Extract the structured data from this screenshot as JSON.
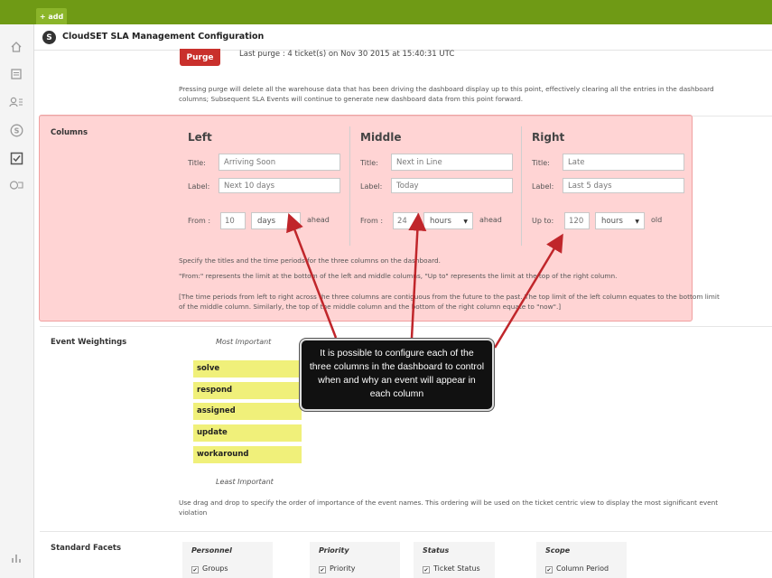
{
  "topbar": {
    "add_label": "+ add"
  },
  "header": {
    "title": "CloudSET SLA Management Configuration"
  },
  "purge": {
    "button_label": "Purge",
    "last_purge": "Last purge : 4 ticket(s) on Nov 30 2015 at 15:40:31 UTC",
    "description": "Pressing purge will delete all the warehouse data that has been driving the dashboard display up to this point, effectively clearing all the entries in the dashboard columns; Subsequent SLA Events will continue to generate new dashboard data from this point forward."
  },
  "columns": {
    "section_label": "Columns",
    "title_label": "Title:",
    "label_label": "Label:",
    "items": [
      {
        "heading": "Left",
        "title": "Arriving Soon",
        "label": "Next 10 days",
        "range_label": "From :",
        "amount": "10",
        "unit": "days",
        "suffix": "ahead"
      },
      {
        "heading": "Middle",
        "title": "Next in Line",
        "label": "Today",
        "range_label": "From :",
        "amount": "24",
        "unit": "hours",
        "suffix": "ahead"
      },
      {
        "heading": "Right",
        "title": "Late",
        "label": "Last 5 days",
        "range_label": "Up to:",
        "amount": "120",
        "unit": "hours",
        "suffix": "old"
      }
    ],
    "desc1": "Specify the titles and the time periods for the three columns on the dashboard.",
    "desc2": "\"From:\" represents the limit at the bottom of the left and middle columns, \"Up to\" represents the limit at the top of the right column.",
    "desc3": "[The time periods from left to right across the three columns are contiguous from the future to the past. The top limit of the left column equates to the bottom limit of the middle column. Similarly, the top of the middle column and the bottom of the right column equate to \"now\".]"
  },
  "event_weightings": {
    "section_label": "Event Weightings",
    "most": "Most Important",
    "least": "Least Important",
    "items": [
      "solve",
      "respond",
      "assigned",
      "update",
      "workaround"
    ],
    "description": "Use drag and drop to specify the order of importance of the event names. This ordering will be used on the ticket centric view to display the most significant event violation"
  },
  "standard_facets": {
    "section_label": "Standard Facets",
    "groups": [
      {
        "title": "Personnel",
        "item": "Groups"
      },
      {
        "title": "Priority",
        "item": "Priority"
      },
      {
        "title": "Status",
        "item": "Ticket Status"
      },
      {
        "title": "Scope",
        "item": "Column Period"
      }
    ]
  },
  "callout": {
    "text": "It is possible to configure each of the three columns in the dashboard to control when and why an event will appear in each column"
  },
  "colors": {
    "topbar": "#6f9a15",
    "purge": "#c9302c",
    "highlight": "#ffa0a0",
    "event_item": "#f0f07a",
    "arrow": "#c0262b"
  },
  "icons": [
    "home-icon",
    "document-icon",
    "users-icon",
    "brand-s-icon",
    "checklist-icon",
    "chat-icon",
    "bar-chart-icon"
  ]
}
